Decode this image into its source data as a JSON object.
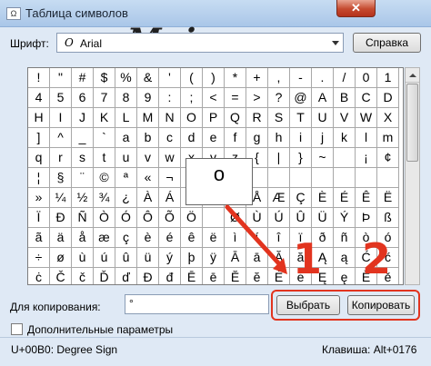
{
  "window": {
    "title": "Таблица символов",
    "close_glyph": "✕"
  },
  "watermark": "Moicom.ru",
  "font": {
    "label": "Шрифт:",
    "value": "Arial",
    "icon": "O"
  },
  "help_button": "Справка",
  "grid": {
    "rows": [
      [
        "!",
        "\"",
        "#",
        "$",
        "%",
        "&",
        "'",
        "(",
        ")",
        "*",
        "+",
        ",",
        "-",
        ".",
        "/",
        "0",
        "1"
      ],
      [
        "4",
        "5",
        "6",
        "7",
        "8",
        "9",
        ":",
        ";",
        "<",
        "=",
        ">",
        "?",
        "@",
        "A",
        "B",
        "C",
        "D"
      ],
      [
        "H",
        "I",
        "J",
        "K",
        "L",
        "M",
        "N",
        "O",
        "P",
        "Q",
        "R",
        "S",
        "T",
        "U",
        "V",
        "W",
        "X"
      ],
      [
        "]",
        "^",
        "_",
        "`",
        "a",
        "b",
        "c",
        "d",
        "e",
        "f",
        "g",
        "h",
        "i",
        "j",
        "k",
        "l",
        "m"
      ],
      [
        "q",
        "r",
        "s",
        "t",
        "u",
        "v",
        "w",
        "x",
        "y",
        "z",
        "{",
        "|",
        "}",
        "~",
        "",
        "¡",
        "¢"
      ],
      [
        "¦",
        "§",
        "¨",
        "©",
        "ª",
        "«",
        "¬",
        "-",
        "",
        "",
        "",
        "",
        "",
        "",
        "",
        "",
        ""
      ],
      [
        "»",
        "¼",
        "½",
        "¾",
        "¿",
        "À",
        "Á",
        "Â",
        "",
        "Ä",
        "Å",
        "Æ",
        "Ç",
        "È",
        "É",
        "Ê",
        "Ë"
      ],
      [
        "Ï",
        "Ð",
        "Ñ",
        "Ò",
        "Ó",
        "Ô",
        "Õ",
        "Ö",
        "",
        "Ø",
        "Ù",
        "Ú",
        "Û",
        "Ü",
        "Ý",
        "Þ",
        "ß"
      ],
      [
        "ã",
        "ä",
        "å",
        "æ",
        "ç",
        "è",
        "é",
        "ê",
        "ë",
        "ì",
        "í",
        "î",
        "ï",
        "ð",
        "ñ",
        "ò",
        "ó"
      ],
      [
        "÷",
        "ø",
        "ù",
        "ú",
        "û",
        "ü",
        "ý",
        "þ",
        "ÿ",
        "Ā",
        "ā",
        "Ă",
        "ă",
        "Ą",
        "ą",
        "Ć",
        "ć"
      ],
      [
        "ċ",
        "Č",
        "č",
        "Ď",
        "ď",
        "Đ",
        "đ",
        "Ē",
        "ē",
        "Ĕ",
        "ĕ",
        "Ė",
        "ė",
        "Ę",
        "ę",
        "Ě",
        "ě"
      ]
    ],
    "magnified_char": "o"
  },
  "copy": {
    "label": "Для копирования:",
    "value": "°"
  },
  "select_button": "Выбрать",
  "copy_button": "Копировать",
  "advanced": {
    "label": "Дополнительные параметры",
    "checked": false
  },
  "status": {
    "char_info": "U+00B0: Degree Sign",
    "shortcut": "Клавиша: Alt+0176"
  },
  "annotations": {
    "step1": "1",
    "step2": "2",
    "color": "#e2341f"
  }
}
